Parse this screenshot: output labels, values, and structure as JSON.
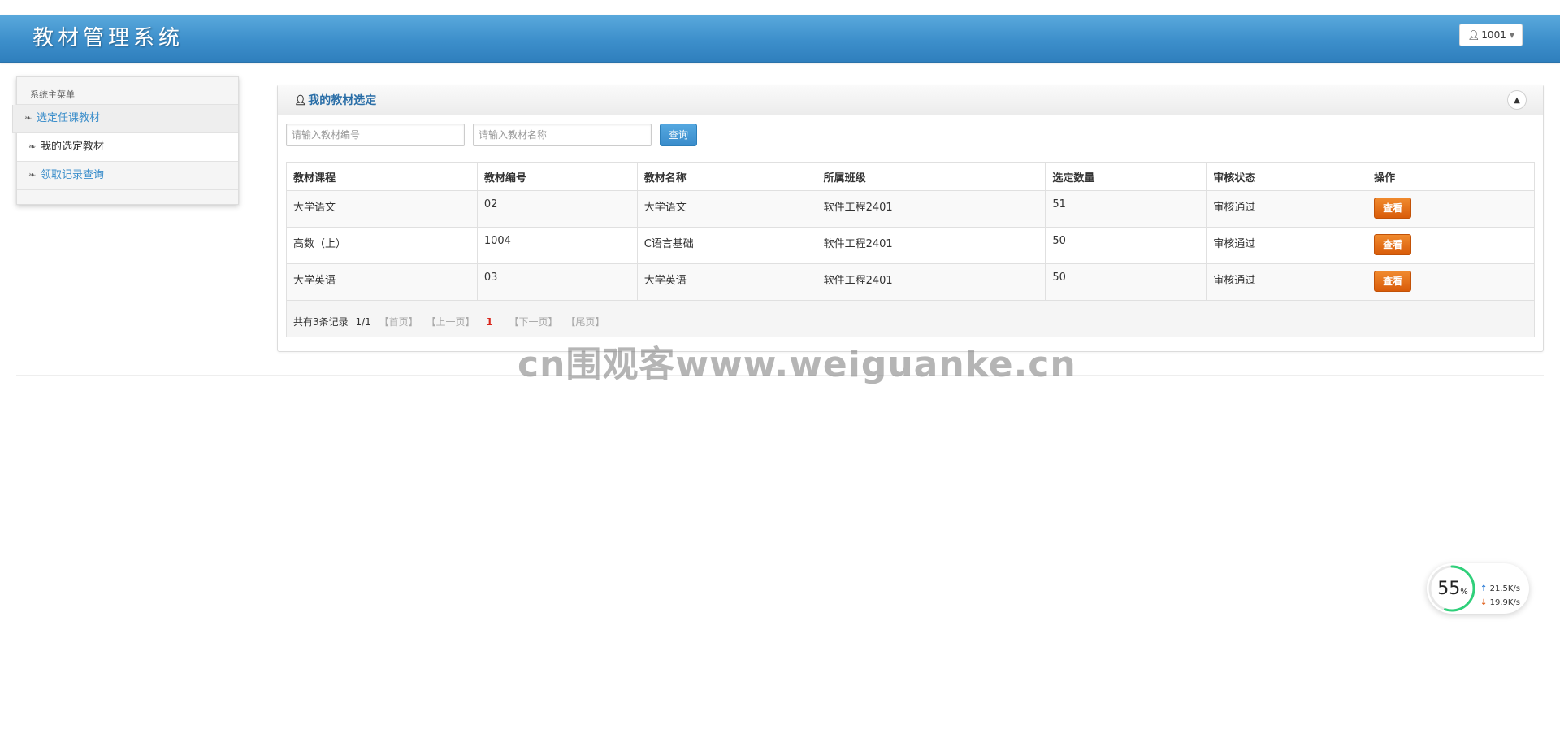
{
  "header": {
    "app_title": "教材管理系统",
    "user_label": "1001"
  },
  "sidebar": {
    "menu_title": "系统主菜单",
    "items": [
      {
        "label": "选定任课教材"
      },
      {
        "label": "我的选定教材"
      },
      {
        "label": "领取记录查询"
      }
    ]
  },
  "panel": {
    "title": "我的教材选定",
    "search": {
      "code_placeholder": "请输入教材编号",
      "name_placeholder": "请输入教材名称",
      "query_label": "查询"
    },
    "table": {
      "columns": [
        "教材课程",
        "教材编号",
        "教材名称",
        "所属班级",
        "选定数量",
        "审核状态",
        "操作"
      ],
      "rows": [
        {
          "course": "大学语文",
          "code": "02",
          "name": "大学语文",
          "class": "软件工程2401",
          "qty": "51",
          "status": "审核通过",
          "action": "查看"
        },
        {
          "course": "高数（上）",
          "code": "1004",
          "name": "C语言基础",
          "class": "软件工程2401",
          "qty": "50",
          "status": "审核通过",
          "action": "查看"
        },
        {
          "course": "大学英语",
          "code": "03",
          "name": "大学英语",
          "class": "软件工程2401",
          "qty": "50",
          "status": "审核通过",
          "action": "查看"
        }
      ]
    },
    "pager": {
      "summary": "共有3条记录",
      "page_info": "1/1",
      "first": "【首页】",
      "prev": "【上一页】",
      "current": "1",
      "next": "【下一页】",
      "last": "【尾页】"
    }
  },
  "watermark": "cn围观客www.weiguanke.cn",
  "net_widget": {
    "percent": "55",
    "percent_unit": "%",
    "percent_value": 55,
    "up_speed": "21.5",
    "down_speed": "19.9",
    "speed_unit": "K/s"
  },
  "colors": {
    "header_blue": "#3d8fcb",
    "link_blue": "#3d8fcb",
    "view_button_orange": "#e06a12",
    "pager_current_red": "#d9261c"
  }
}
